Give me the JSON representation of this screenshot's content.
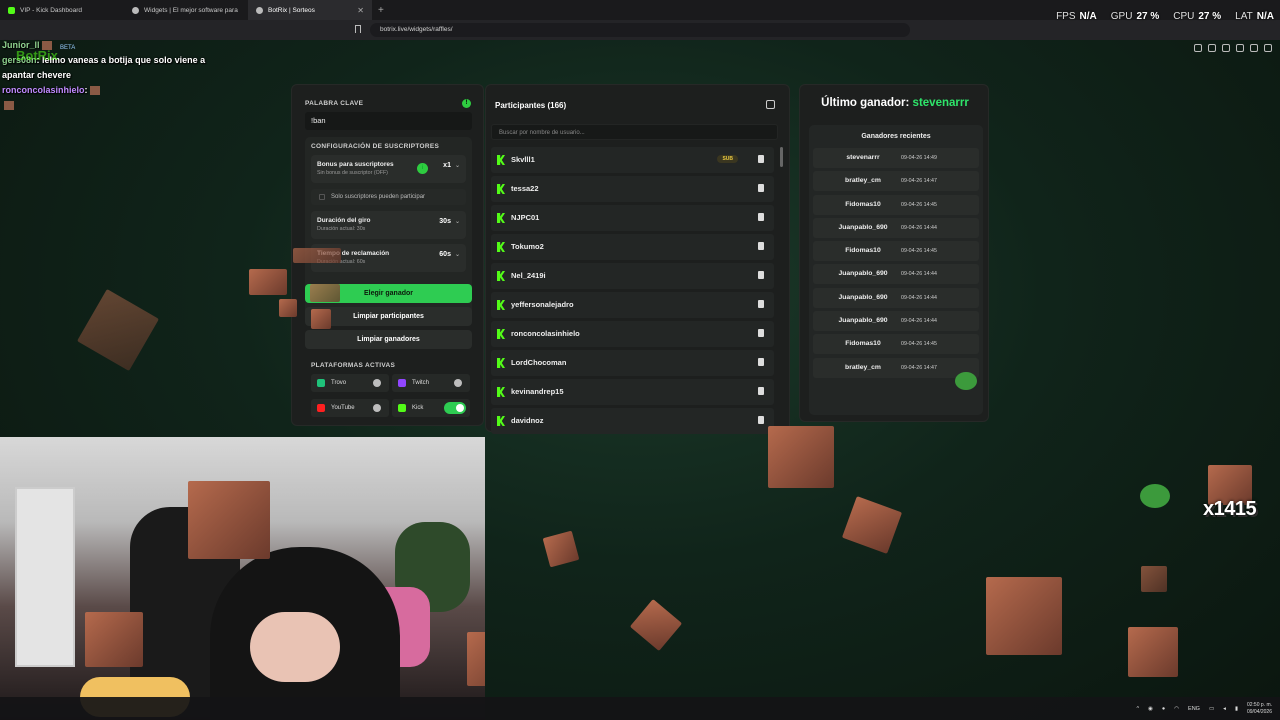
{
  "browser": {
    "tabs": [
      {
        "label": "VIP - Kick Dashboard"
      },
      {
        "label": "Widgets | El mejor software para pc..."
      },
      {
        "label": "BotRix | Sorteos"
      }
    ],
    "url": "botrix.live/widgets/raffles/"
  },
  "overlay_stats": {
    "fps_label": "FPS",
    "fps_value": "N/A",
    "gpu_label": "GPU",
    "gpu_value": "27 %",
    "cpu_label": "CPU",
    "cpu_value": "27 %",
    "lat_label": "LAT",
    "lat_value": "N/A"
  },
  "chat": {
    "line1_user": "Junior_ll",
    "line2_user": "gers08n",
    "line2_text": ": lelmo vaneas a botija que solo viene a apantar chevere",
    "line3_user": "ronconcolasinhielo",
    "line3_text": ":"
  },
  "logo": {
    "name": "BotRix",
    "badge": "BETA"
  },
  "raffle": {
    "keyword_label": "PALABRA CLAVE",
    "keyword_value": "!ban",
    "sub_config_label": "CONFIGURACIÓN DE SUSCRIPTORES",
    "bonus_title": "Bonus para suscriptores",
    "bonus_sub": "Sin bonus de suscriptor (OFF)",
    "bonus_value": "x1",
    "subs_only_label": "Solo suscriptores pueden participar",
    "spin_title": "Duración del giro",
    "spin_sub": "Duración actual: 30s",
    "spin_value": "30s",
    "claim_title": "Tiempo de reclamación",
    "claim_sub": "Duración actual: 60s",
    "claim_value": "60s",
    "btn_pick": "Elegir ganador",
    "btn_clear_participants": "Limpiar participantes",
    "btn_clear_winners": "Limpiar ganadores",
    "platforms_label": "PLATAFORMAS ACTIVAS",
    "platforms": [
      {
        "name": "Trovo",
        "on": false
      },
      {
        "name": "Twitch",
        "on": false
      },
      {
        "name": "YouTube",
        "on": false
      },
      {
        "name": "Kick",
        "on": true
      }
    ]
  },
  "participants": {
    "title": "Participantes (166)",
    "search_placeholder": "Buscar por nombre de usuario...",
    "sub_badge": "SUB",
    "items": [
      "Skvlll1",
      "tessa22",
      "NJPC01",
      "Tokumo2",
      "Nel_2419i",
      "yeffersonalejadro",
      "ronconcolasinhielo",
      "LordChocoman",
      "kevinandrep15",
      "davidnoz"
    ]
  },
  "winners": {
    "title_prefix": "Último ganador:",
    "last_winner": "stevenarrr",
    "recent_title": "Ganadores recientes",
    "items": [
      {
        "name": "stevenarrr",
        "date": "09-04-26 14:49"
      },
      {
        "name": "bratley_cm",
        "date": "09-04-26 14:47"
      },
      {
        "name": "Fidomas10",
        "date": "09-04-26 14:45"
      },
      {
        "name": "Juanpablo_690",
        "date": "09-04-26 14:44"
      },
      {
        "name": "Fidomas10",
        "date": "09-04-26 14:45"
      },
      {
        "name": "Juanpablo_690",
        "date": "09-04-26 14:44"
      },
      {
        "name": "Juanpablo_690",
        "date": "09-04-26 14:44"
      },
      {
        "name": "Juanpablo_690",
        "date": "09-04-26 14:44"
      },
      {
        "name": "Fidomas10",
        "date": "09-04-26 14:45"
      },
      {
        "name": "bratley_cm",
        "date": "09-04-26 14:47"
      }
    ]
  },
  "emote_counter": "x1415",
  "taskbar": {
    "lang": "ENG",
    "time": "02:50 p. m.",
    "date": "09/04/2026"
  },
  "colors": {
    "accent_green": "#2ecc52",
    "kick_green": "#53fc18",
    "winner_green": "#2ee56a"
  }
}
